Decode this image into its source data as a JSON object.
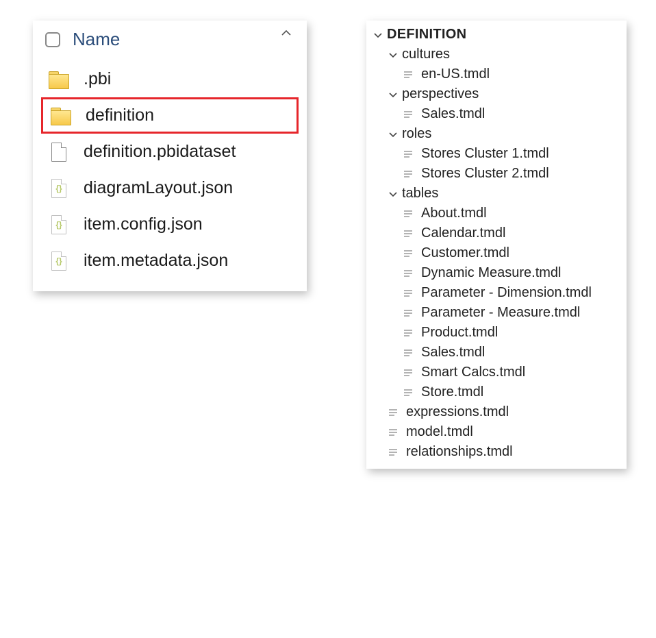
{
  "explorer": {
    "name_header": "Name",
    "items": [
      {
        "label": ".pbi",
        "icon": "folder",
        "highlighted": false
      },
      {
        "label": "definition",
        "icon": "folder",
        "highlighted": true
      },
      {
        "label": "definition.pbidataset",
        "icon": "doc",
        "highlighted": false
      },
      {
        "label": "diagramLayout.json",
        "icon": "json",
        "highlighted": false
      },
      {
        "label": "item.config.json",
        "icon": "json",
        "highlighted": false
      },
      {
        "label": "item.metadata.json",
        "icon": "json",
        "highlighted": false
      }
    ]
  },
  "tree": {
    "root_label": "DEFINITION",
    "folders": [
      {
        "label": "cultures",
        "files": [
          "en-US.tmdl"
        ]
      },
      {
        "label": "perspectives",
        "files": [
          "Sales.tmdl"
        ]
      },
      {
        "label": "roles",
        "files": [
          "Stores Cluster 1.tmdl",
          "Stores Cluster 2.tmdl"
        ]
      },
      {
        "label": "tables",
        "files": [
          "About.tmdl",
          "Calendar.tmdl",
          "Customer.tmdl",
          "Dynamic Measure.tmdl",
          "Parameter - Dimension.tmdl",
          "Parameter - Measure.tmdl",
          "Product.tmdl",
          "Sales.tmdl",
          "Smart Calcs.tmdl",
          "Store.tmdl"
        ]
      }
    ],
    "root_files": [
      "expressions.tmdl",
      "model.tmdl",
      "relationships.tmdl"
    ]
  }
}
